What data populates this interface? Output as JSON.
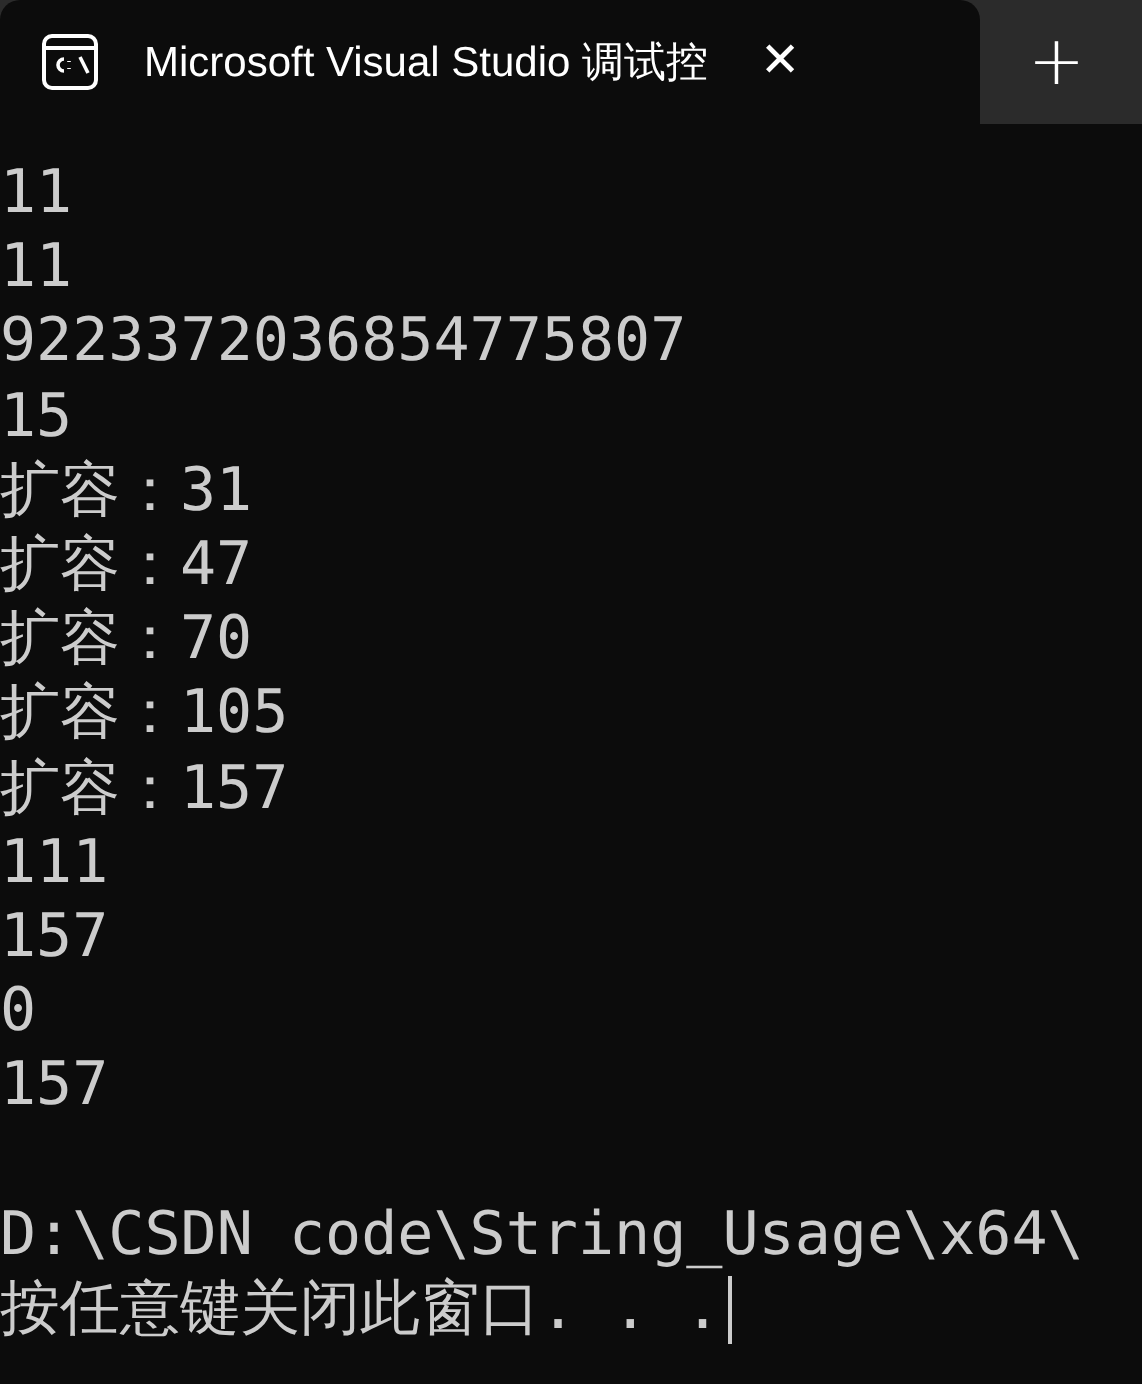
{
  "tab": {
    "title": "Microsoft Visual Studio 调试控",
    "close": "✕",
    "selected": true
  },
  "new_tab": "+",
  "output": [
    "11",
    "11",
    "9223372036854775807",
    "15",
    "扩容：31",
    "扩容：47",
    "扩容：70",
    "扩容：105",
    "扩容：157",
    "111",
    "157",
    "0",
    "157"
  ],
  "exit_message": {
    "path": "D:\\CSDN code\\String_Usage\\x64\\",
    "prompt": "按任意键关闭此窗口. . ."
  }
}
